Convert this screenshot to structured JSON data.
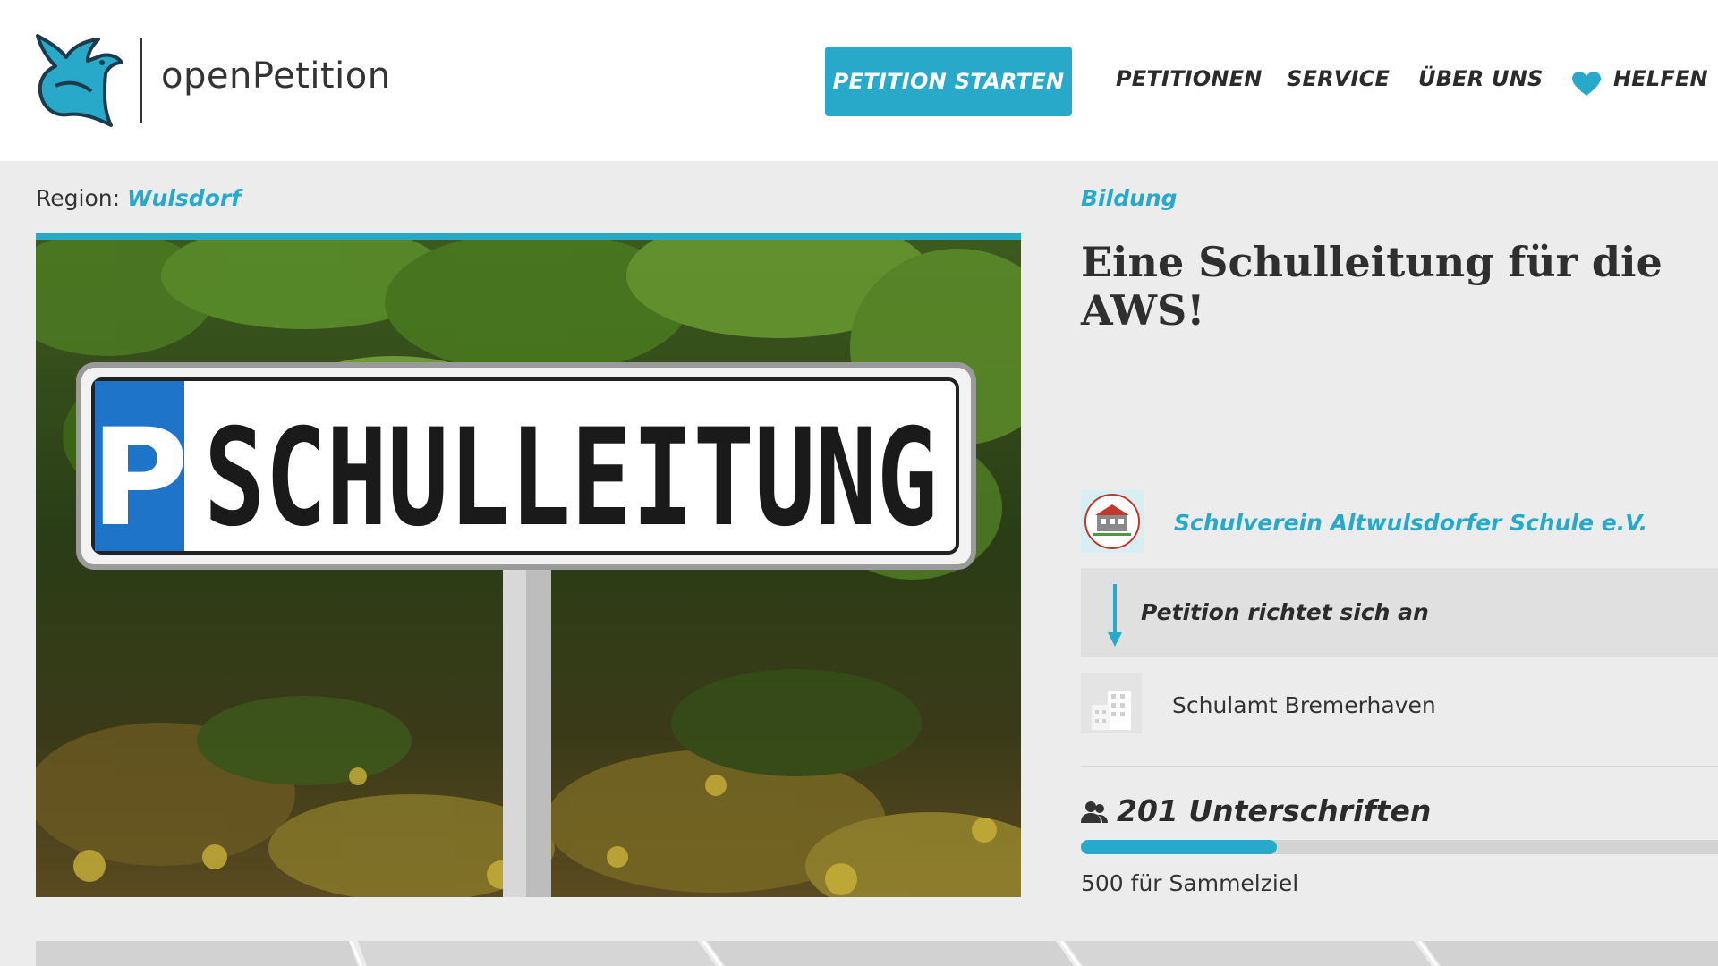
{
  "brand": {
    "name": "openPetition",
    "accent": "#29a9c9"
  },
  "nav": {
    "start_label": "PETITION STARTEN",
    "items": [
      "PETITIONEN",
      "SERVICE",
      "ÜBER UNS",
      "HELFEN"
    ]
  },
  "region": {
    "label": "Region:",
    "value": "Wulsdorf"
  },
  "category": "Bildung",
  "petition": {
    "title": "Eine Schulleitung für die AWS!",
    "image_text": "SCHULLEITUNG",
    "image_sign_prefix": "P",
    "initiator": "Schulverein Altwulsdorfer Schule e.V.",
    "addressee_label": "Petition richtet sich an",
    "recipient": "Schulamt Bremerhaven"
  },
  "signatures": {
    "text": "201 Unterschriften",
    "count": 201,
    "goal": 500,
    "goal_text": "500 für Sammelziel"
  }
}
